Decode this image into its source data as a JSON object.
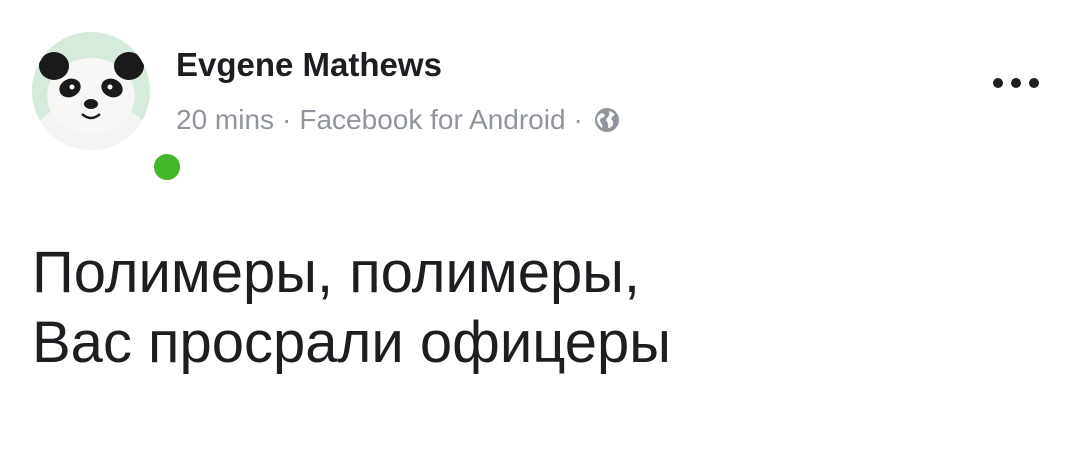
{
  "post": {
    "author": "Evgene Mathews",
    "meta": {
      "time": "20 mins",
      "separator": "·",
      "source": "Facebook for Android",
      "privacy_icon": "globe-icon"
    },
    "text_lines": [
      "Полимеры, полимеры,",
      "Вас просрали офицеры"
    ],
    "avatar_icon": "panda-avatar",
    "online_status_color": "#42b72a",
    "more_icon": "more-options-icon"
  }
}
